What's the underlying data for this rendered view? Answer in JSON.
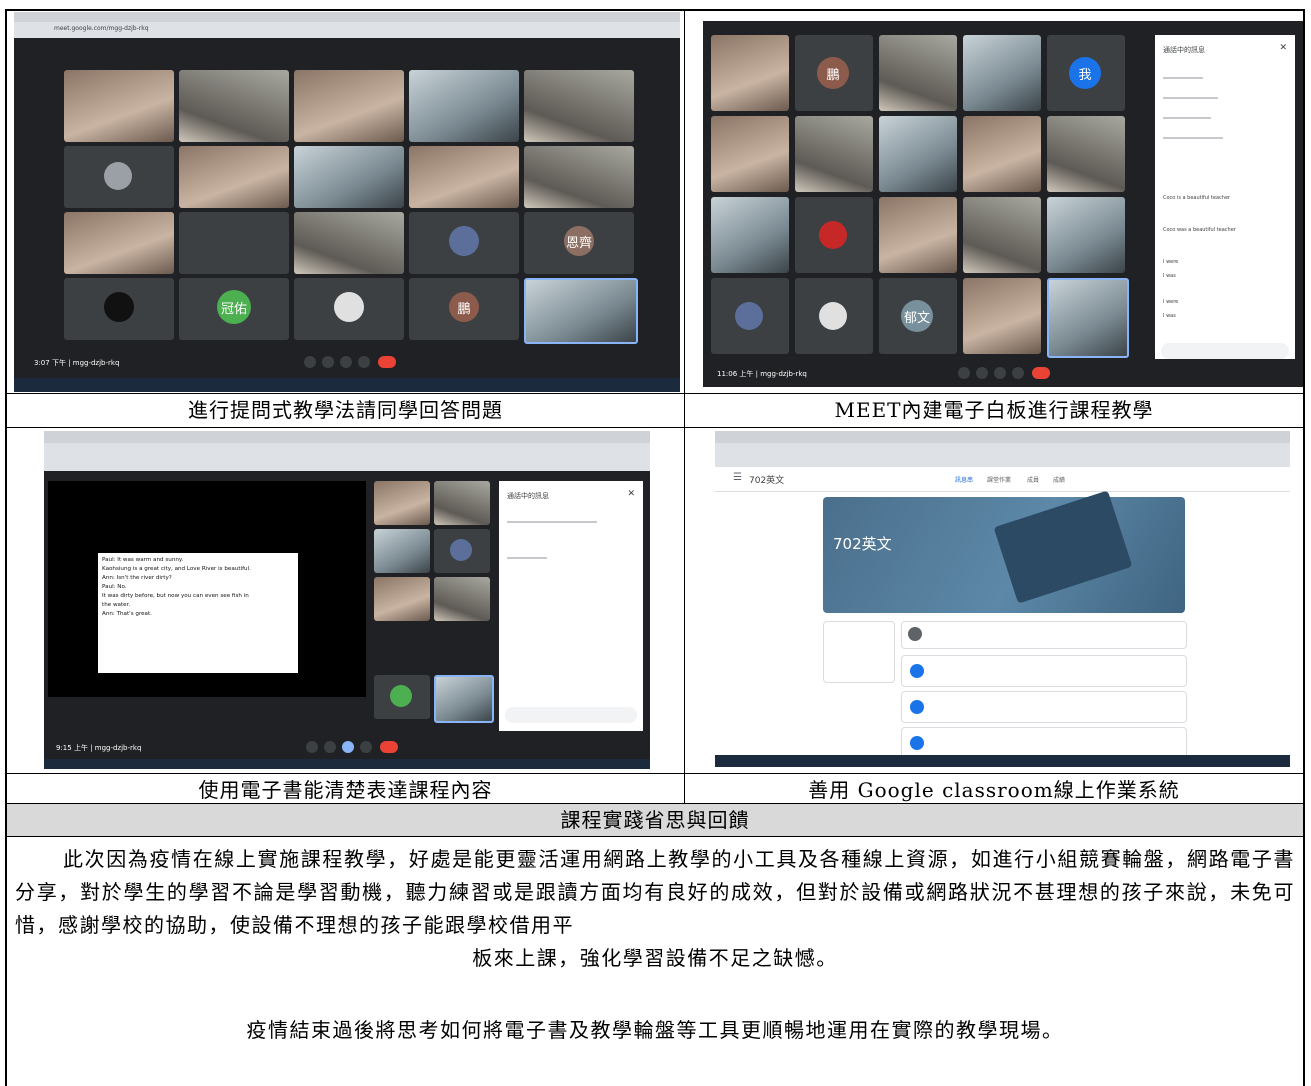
{
  "captions": {
    "top_left": "進行提問式教學法請同學回答問題",
    "top_right": "MEET內建電子白板進行課程教學",
    "mid_left": "使用電子書能清楚表達課程內容",
    "mid_right": "善用 Google classroom線上作業系統"
  },
  "section_title": "課程實踐省思與回饋",
  "paragraph_1": "此次因為疫情在線上實施課程教學，好處是能更靈活運用網路上教學的小工具及各種線上資源，如進行小組競賽輪盤，網路電子書分享，對於學生的學習不論是學習動機，聽力練習或是跟讀方面均有良好的成效，但對於設備或網路狀況不甚理想的孩子來說，未免可惜，感謝學校的協助，使設備不理想的孩子能跟學校借用平",
  "paragraph_1_end": "板來上課，強化學習設備不足之缺憾。",
  "paragraph_2": "疫情結束過後將思考如何將電子書及教學輪盤等工具更順暢地運用在實際的教學現場。",
  "screens": {
    "meet_1": {
      "url": "meet.google.com/mgg-dzjb-rkq",
      "time_code": "3:07 下午 | mgg-dzjb-rkq",
      "avatar_labels": [
        "冠佑",
        "鵬",
        "恩齊"
      ]
    },
    "meet_2": {
      "time_code": "11:06 上午 | mgg-dzjb-rkq",
      "chat_title": "通話中的訊息",
      "avatar_labels": [
        "鵬",
        "我",
        "郁文"
      ],
      "chat_lines": [
        "Coco is a beautiful teacher",
        "Coco was a beautiful teacher",
        "I were",
        "I was",
        "I were",
        "I was"
      ]
    },
    "ebook": {
      "time_code": "9:15 上午 | mgg-dzjb-rkq",
      "chat_title": "通話中的訊息",
      "text_lines": [
        "Paul: It was warm and sunny.",
        "Kaohsiung is a great city, and Love River is beautiful.",
        "Ann: Isn't the river dirty?",
        "Paul: No.",
        "It was dirty before, but now you can even see fish in",
        "the water.",
        "Ann: That's great."
      ]
    },
    "classroom": {
      "app_title": "702英文",
      "banner_title": "702英文",
      "tabs": [
        "訊息串",
        "課堂作業",
        "成員",
        "成績"
      ]
    }
  }
}
